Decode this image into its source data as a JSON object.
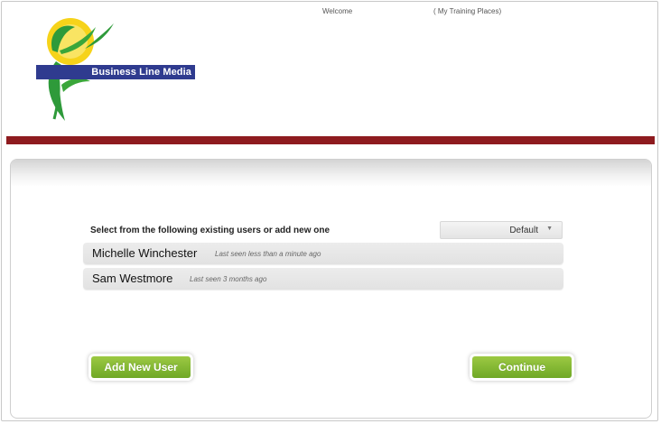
{
  "header": {
    "logo_text": "Business Line Media",
    "welcome_label": "Welcome",
    "training_link": "( My Training Places)"
  },
  "main": {
    "select_label": "Select from the following existing users or add new one",
    "dropdown": {
      "selected": "Default"
    },
    "users": [
      {
        "name": "Michelle Winchester",
        "last_seen": "Last seen less than a minute ago"
      },
      {
        "name": "Sam Westmore",
        "last_seen": "Last seen 3 months ago"
      }
    ],
    "add_user_label": "Add New User",
    "continue_label": "Continue"
  },
  "colors": {
    "brand_blue": "#2f3b8f",
    "accent_red": "#8e1b1f",
    "button_green": "#7db52f",
    "logo_yellow": "#f7d51c",
    "logo_green": "#2e9a3a"
  }
}
